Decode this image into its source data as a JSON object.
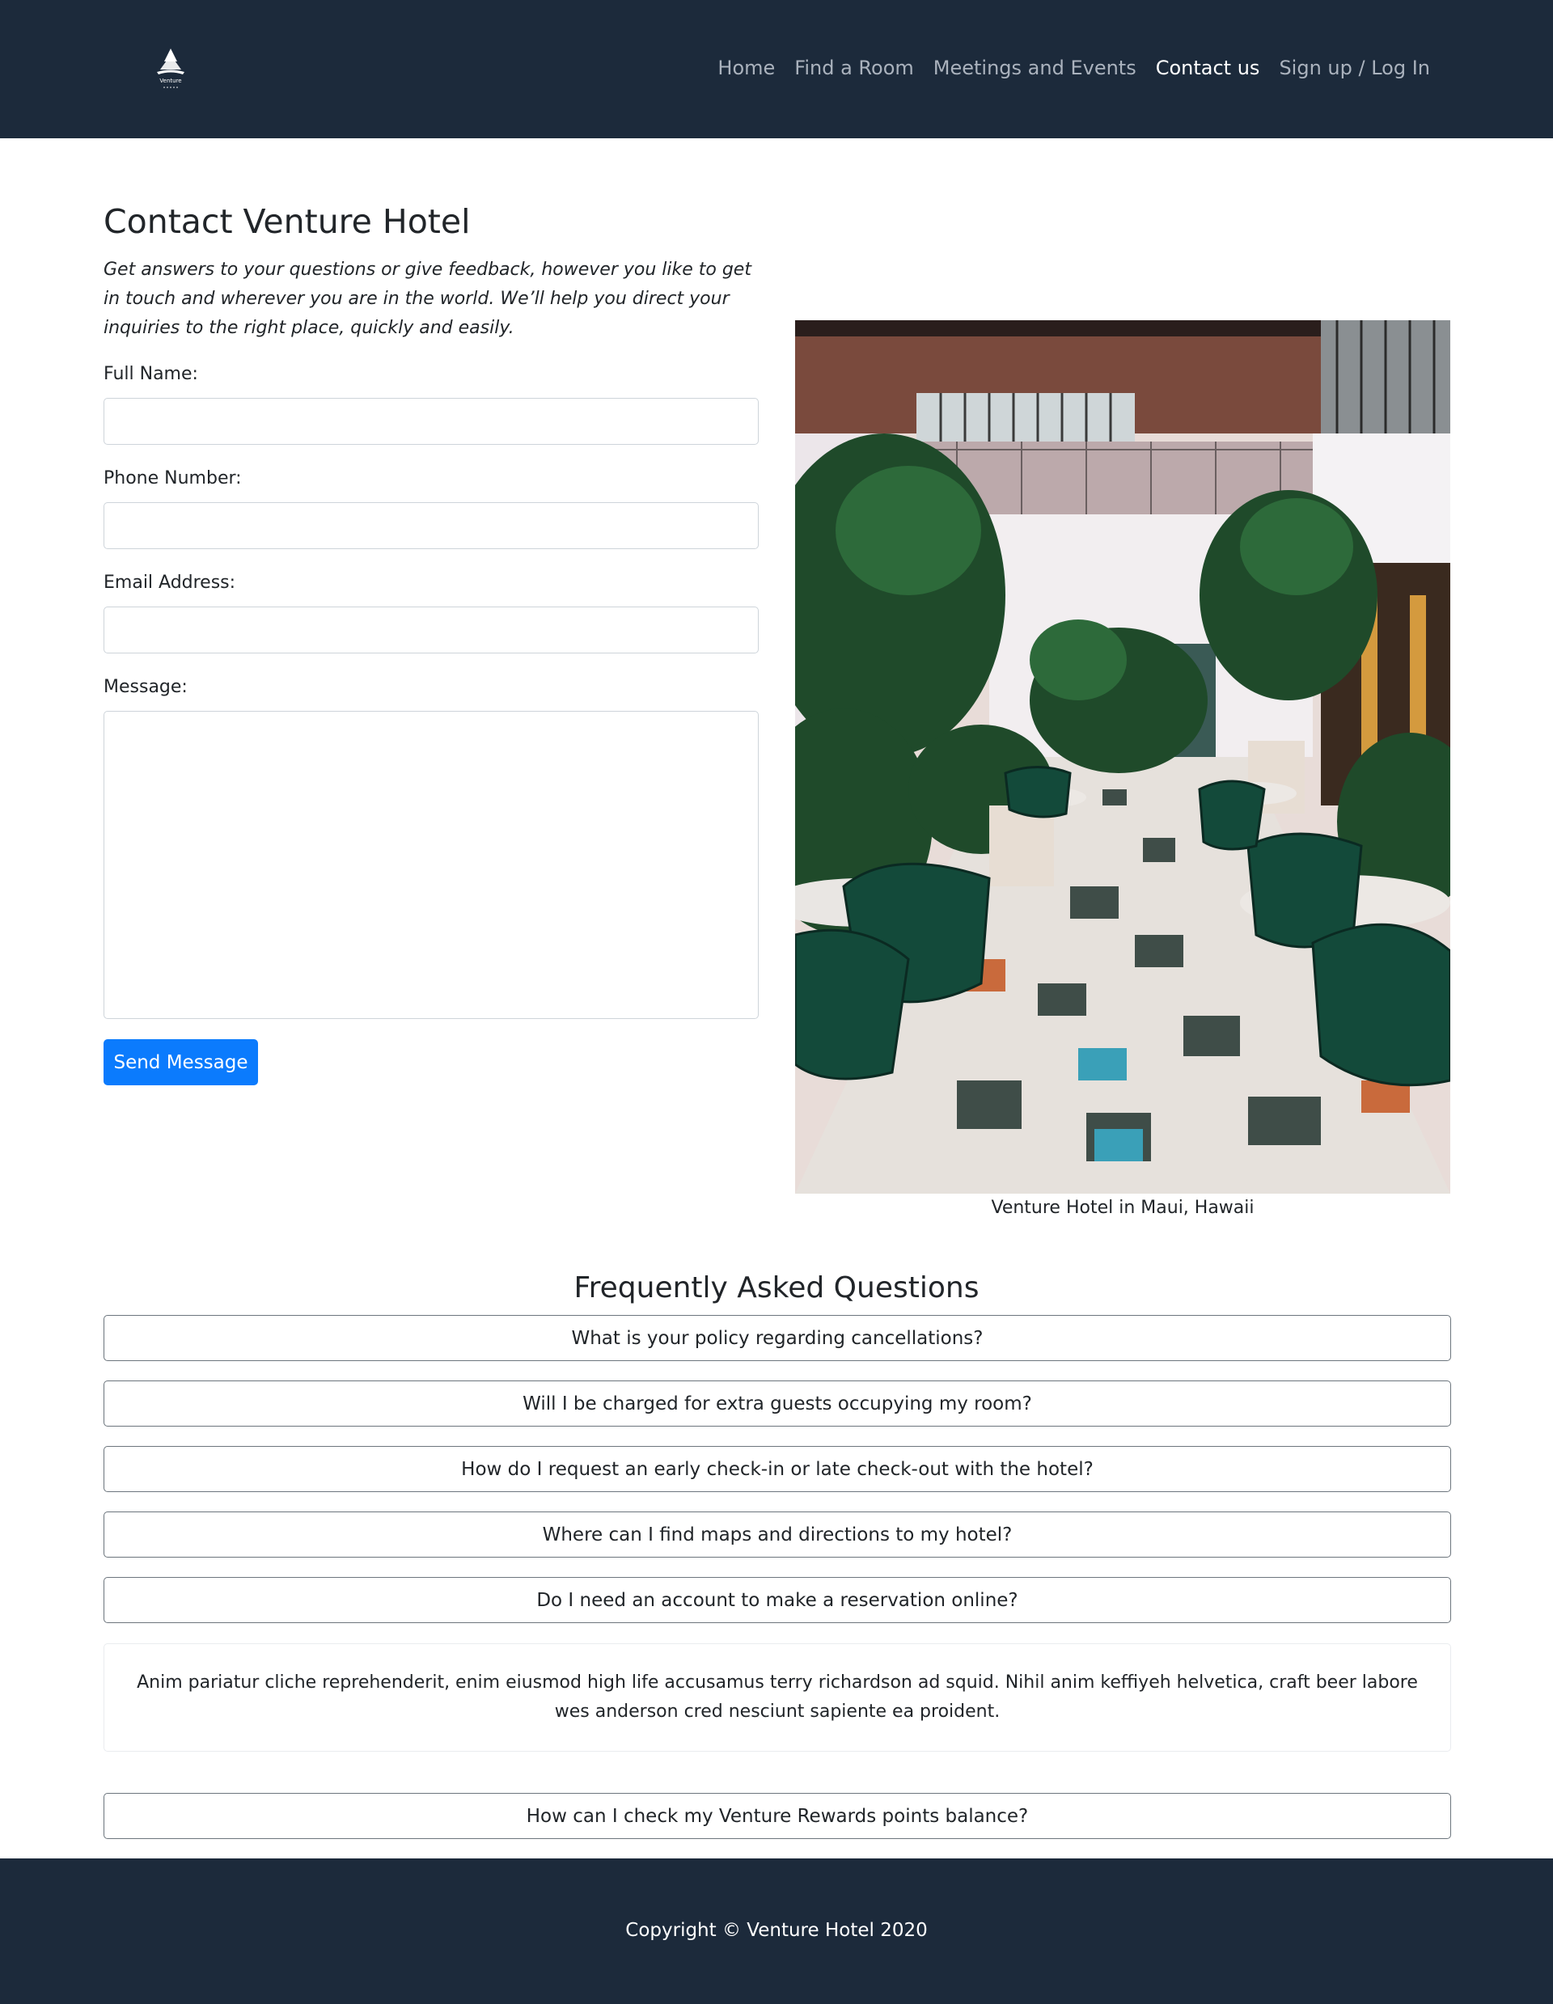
{
  "brand": {
    "logo_text": "Venture",
    "icon": "hotel-sail-logo",
    "nav_bg": "#1c2a3b"
  },
  "nav": {
    "items": [
      {
        "label": "Home",
        "active": false
      },
      {
        "label": "Find a Room",
        "active": false
      },
      {
        "label": "Meetings and Events",
        "active": false
      },
      {
        "label": "Contact us",
        "active": true
      },
      {
        "label": "Sign up / Log In",
        "active": false
      }
    ]
  },
  "contact": {
    "title": "Contact Venture Hotel",
    "intro": "Get answers to your questions or give feedback, however you like to get in touch and wherever you are in the world. We’ll help you direct your inquiries to the right place, quickly and easily.",
    "fields": {
      "full_name": {
        "label": "Full Name:",
        "value": "",
        "placeholder": ""
      },
      "phone": {
        "label": "Phone Number:",
        "value": "",
        "placeholder": ""
      },
      "email": {
        "label": "Email Address:",
        "value": "",
        "placeholder": ""
      },
      "message": {
        "label": "Message:",
        "value": "",
        "placeholder": ""
      }
    },
    "send_label": "Send Message",
    "button_color": "#0b7bfd"
  },
  "photo": {
    "caption": "Venture Hotel in Maui, Hawaii"
  },
  "faq": {
    "title": "Frequently Asked Questions",
    "questions": [
      "What is your policy regarding cancellations?",
      "Will I be charged for extra guests occupying my room?",
      "How do I request an early check-in or late check-out with the hotel?",
      "Where can I find maps and directions to my hotel?",
      "Do I need an account to make a reservation online?",
      "How can I check my Venture Rewards points balance?"
    ],
    "expanded_answer": "Anim pariatur cliche reprehenderit, enim eiusmod high life accusamus terry richardson ad squid. Nihil anim keffiyeh helvetica, craft beer labore wes anderson cred nesciunt sapiente ea proident."
  },
  "footer": {
    "copyright": "Copyright © Venture Hotel 2020"
  }
}
